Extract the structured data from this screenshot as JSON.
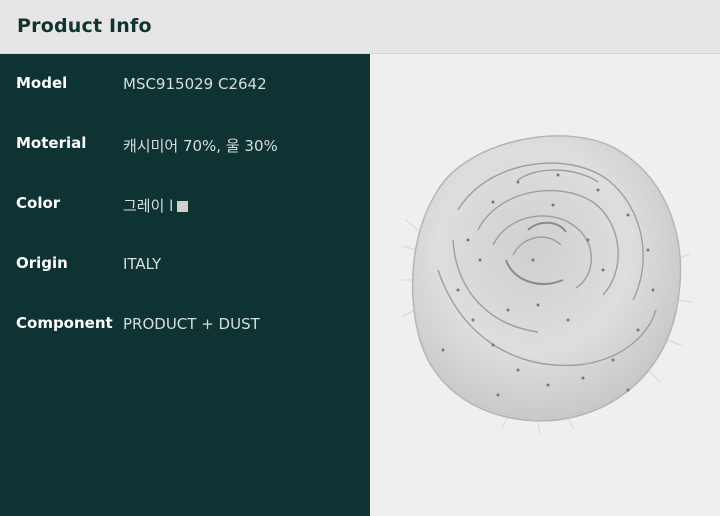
{
  "header": {
    "title": "Product Info"
  },
  "specs": [
    {
      "label": "Model",
      "value": "MSC915029 C2642"
    },
    {
      "label": "Moterial",
      "value": "캐시미어 70%, 울 30%"
    },
    {
      "label": "Color",
      "value": "그레이 l"
    },
    {
      "label": "Origin",
      "value": "ITALY"
    },
    {
      "label": "Component",
      "value": "PRODUCT + DUST"
    }
  ],
  "colors": {
    "header_bg": "#e6e6e6",
    "panel_bg": "#0f3333",
    "swatch": "#cfcfcf",
    "image_bg": "#efefef"
  },
  "image": {
    "subject": "rolled grey cashmere scarf with fringe and sequin dots"
  }
}
